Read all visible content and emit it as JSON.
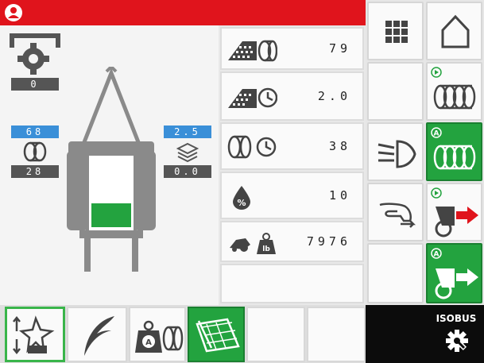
{
  "status_bar": {
    "color": "#e0141c"
  },
  "bale_chamber": {
    "top_value": "0",
    "left_top_value": "68",
    "left_bottom_value": "28",
    "right_top_value": "2.5",
    "right_bottom_value": "0.0"
  },
  "counters": [
    {
      "icon": "bales-count-icon",
      "value": "79"
    },
    {
      "icon": "bales-per-time-icon",
      "value": "2.0"
    },
    {
      "icon": "bale-time-icon",
      "value": "38"
    },
    {
      "icon": "moisture-percent-icon",
      "value": "10"
    },
    {
      "icon": "bale-weight-lb-icon",
      "value": "7976"
    }
  ],
  "right_buttons": {
    "menu": "grid-menu-icon",
    "home": "home-icon",
    "light": "work-light-icon",
    "gesture": "hand-gesture-icon"
  },
  "isobus": {
    "label": "ISOBUS"
  },
  "colors": {
    "accent_green": "#23a33f",
    "info_blue": "#3a8fd8",
    "status_red": "#e0141c"
  }
}
